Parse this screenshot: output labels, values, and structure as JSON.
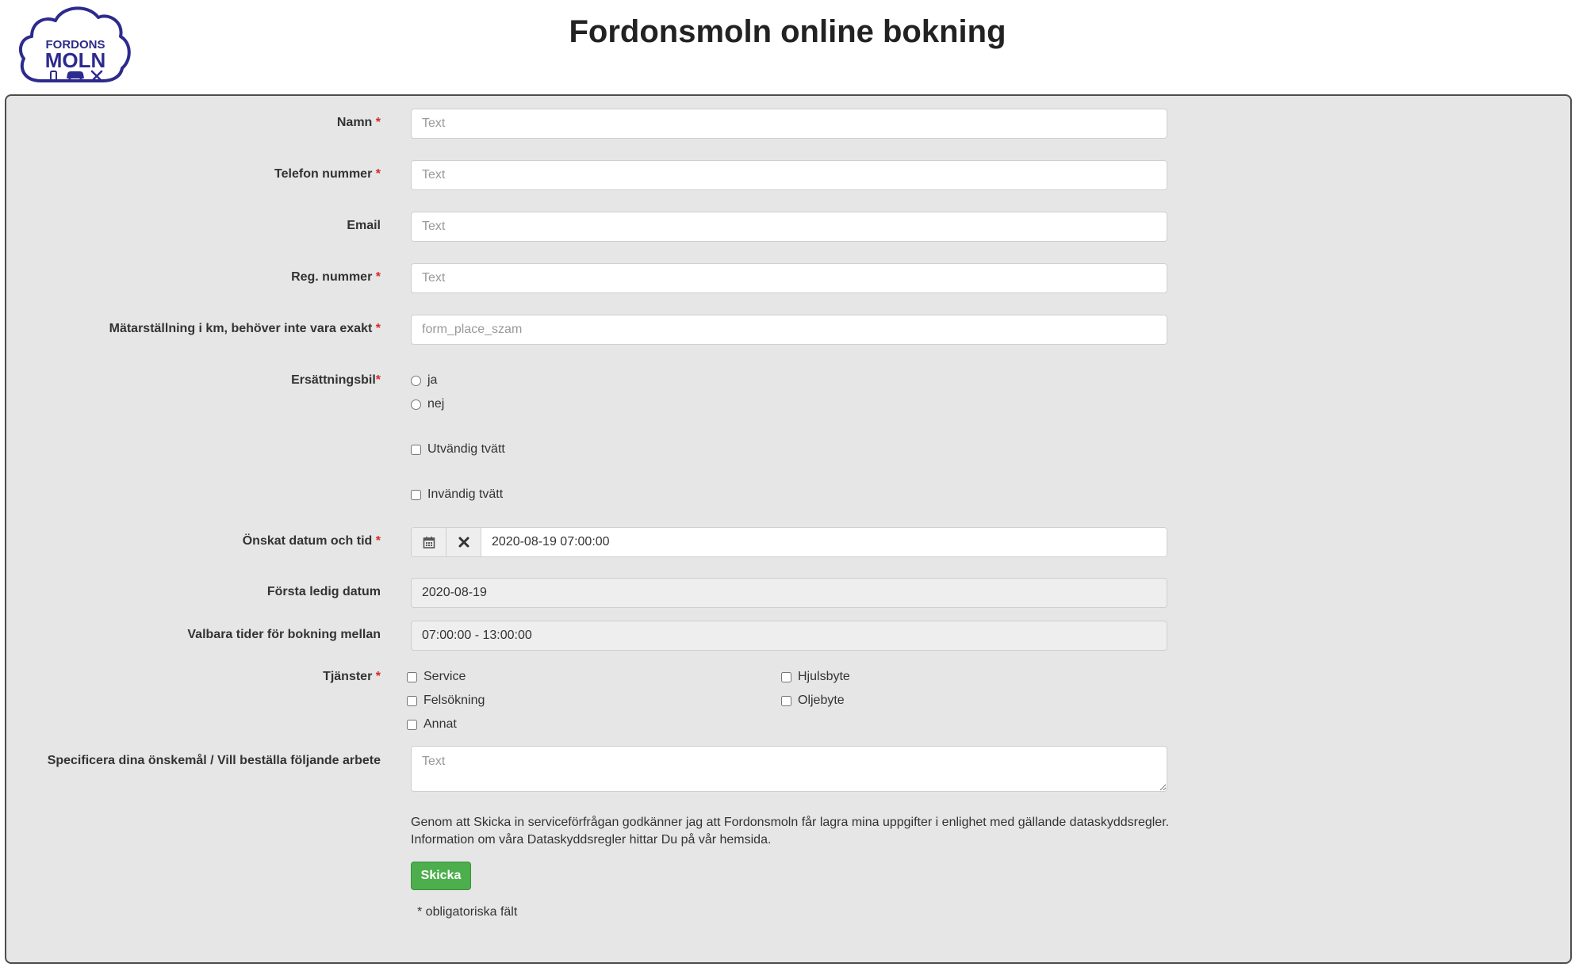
{
  "page": {
    "title": "Fordonsmoln online bokning",
    "logo": {
      "line1": "FORDONS",
      "line2": "MOLN"
    }
  },
  "colors": {
    "logo": "#2d2a8e",
    "required_star": "#d9262c",
    "submit_button": "#4cae4c",
    "panel_background": "#e6e6e6"
  },
  "form": {
    "required_marker": "*",
    "name": {
      "label": "Namn",
      "placeholder": "Text"
    },
    "phone": {
      "label": "Telefon nummer",
      "placeholder": "Text"
    },
    "email": {
      "label": "Email",
      "placeholder": "Text"
    },
    "reg_number": {
      "label": "Reg. nummer",
      "placeholder": "Text"
    },
    "odometer": {
      "label": "Mätarställning i km, behöver inte vara exakt",
      "placeholder": "form_place_szam"
    },
    "replacement_car": {
      "label": "Ersättningsbil",
      "options": [
        "ja",
        "nej"
      ]
    },
    "exterior_wash": {
      "label": "Utvändig tvätt"
    },
    "interior_wash": {
      "label": "Invändig tvätt"
    },
    "desired_datetime": {
      "label": "Önskat datum och tid",
      "value": "2020-08-19 07:00:00",
      "calendar_icon": "calendar-icon",
      "clear_icon": "close-icon"
    },
    "first_available_date": {
      "label": "Första ledig datum",
      "value": "2020-08-19"
    },
    "booking_times": {
      "label": "Valbara tider för bokning mellan",
      "value": "07:00:00 - 13:00:00"
    },
    "services": {
      "label": "Tjänster",
      "options": [
        "Service",
        "Hjulsbyte",
        "Felsökning",
        "Oljebyte",
        "Annat"
      ]
    },
    "specify": {
      "label": "Specificera dina önskemål / Vill beställa följande arbete",
      "placeholder": "Text"
    },
    "consent_line1": "Genom att Skicka in serviceförfrågan godkänner jag att Fordonsmoln får lagra mina uppgifter i enlighet med gällande dataskyddsregler.",
    "consent_line2": "Information om våra Dataskyddsregler hittar Du på vår hemsida.",
    "submit_label": "Skicka",
    "footnote": "* obligatoriska fält"
  }
}
